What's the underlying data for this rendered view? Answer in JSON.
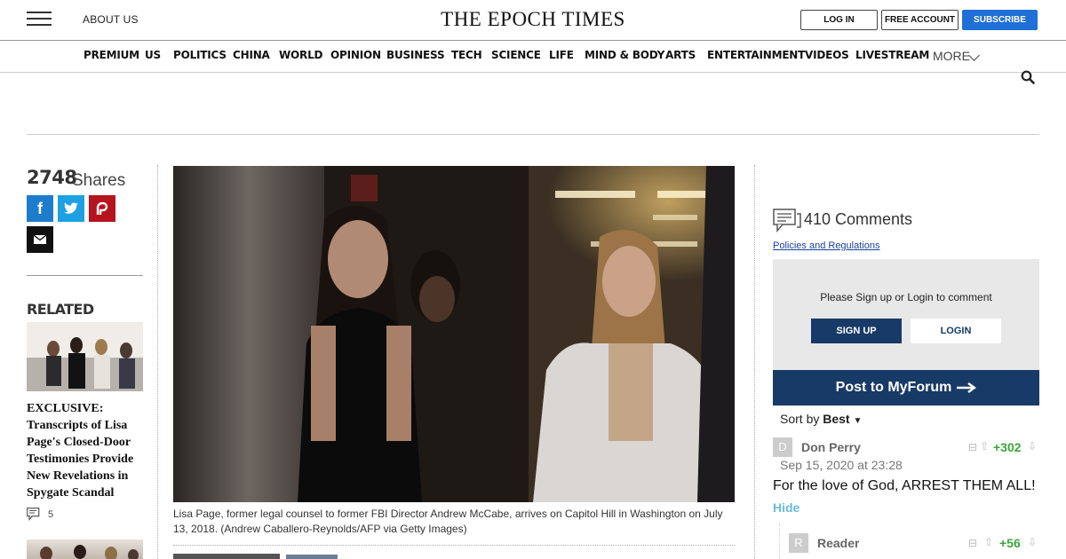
{
  "header": {
    "about_label": "ABOUT US",
    "logo_text": "THE EPOCH TIMES",
    "login_label": "LOG IN",
    "free_account_label": "FREE ACCOUNT",
    "subscribe_label": "SUBSCRIBE"
  },
  "nav": {
    "items": [
      "PREMIUM",
      "US",
      "POLITICS",
      "CHINA",
      "WORLD",
      "OPINION",
      "BUSINESS",
      "TECH",
      "SCIENCE",
      "LIFE",
      "MIND & BODY",
      "ARTS",
      "ENTERTAINMENT",
      "VIDEOS",
      "LIVESTREAM"
    ],
    "more_label": "MORE"
  },
  "share": {
    "count": "2748",
    "label": "Shares"
  },
  "related": {
    "heading": "RELATED",
    "items": [
      {
        "title": "EXCLUSIVE: Transcripts of Lisa Page's Closed-Door Testimonies Provide New Revelations in Spygate Scandal",
        "comments": "5"
      }
    ]
  },
  "article": {
    "caption": "Lisa Page, former legal counsel to former FBI Director Andrew McCabe, arrives on Capitol Hill in Washington on July 13, 2018. (Andrew Caballero-Reynolds/AFP via Getty Images)"
  },
  "comments": {
    "count_label": "410 Comments",
    "policies_label": "Policies and Regulations",
    "signin_prompt": "Please Sign up or Login to comment",
    "signup_label": "SIGN UP",
    "login_label": "LOGIN",
    "post_label": "Post to MyForum",
    "sort_label": "Sort by",
    "sort_value": "Best",
    "list": [
      {
        "avatar": "D",
        "author": "Don Perry",
        "date": "Sep 15, 2020 at 23:28",
        "votes": "+302",
        "text": "For the love of God, ARREST THEM ALL!",
        "hide_label": "Hide"
      },
      {
        "avatar": "R",
        "author": "Reader",
        "votes": "+56"
      }
    ]
  },
  "colors": {
    "brand_blue": "#1f6fd6",
    "forum_navy": "#183a66",
    "vote_green": "#3aa53a",
    "paywall_red": "#b5131d"
  }
}
